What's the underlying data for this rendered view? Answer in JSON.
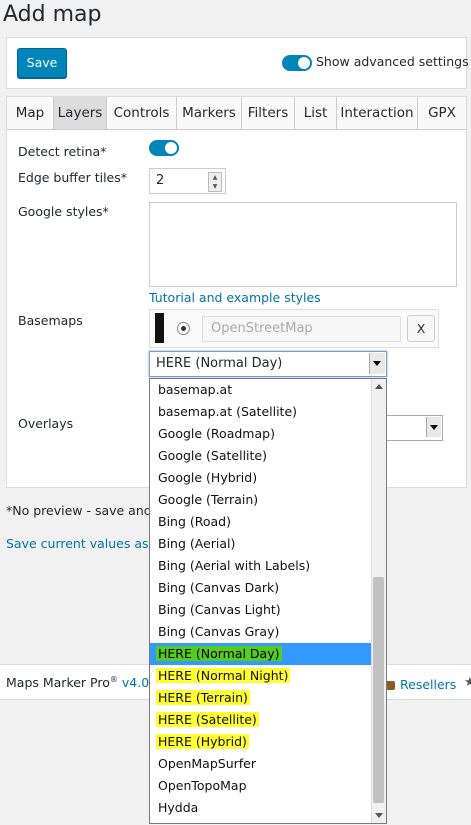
{
  "page": {
    "title": "Add map"
  },
  "topbar": {
    "save_label": "Save",
    "advanced_label": "Show advanced settings"
  },
  "tabs": [
    {
      "label": "Map"
    },
    {
      "label": "Layers"
    },
    {
      "label": "Controls"
    },
    {
      "label": "Markers"
    },
    {
      "label": "Filters"
    },
    {
      "label": "List"
    },
    {
      "label": "Interaction"
    },
    {
      "label": "GPX"
    }
  ],
  "layers": {
    "detect_retina_label": "Detect retina*",
    "edge_buffer_label": "Edge buffer tiles*",
    "edge_buffer_value": "2",
    "google_styles_label": "Google styles*",
    "tutorial_link": "Tutorial and example styles",
    "basemaps_label": "Basemaps",
    "basemap_placeholder": "OpenStreetMap",
    "remove_label": "X",
    "overlays_label": "Overlays",
    "select_value": "HERE (Normal Day)"
  },
  "dropdown": {
    "options": [
      "basemap.at",
      "basemap.at (Satellite)",
      "Google (Roadmap)",
      "Google (Satellite)",
      "Google (Hybrid)",
      "Google (Terrain)",
      "Bing (Road)",
      "Bing (Aerial)",
      "Bing (Aerial with Labels)",
      "Bing (Canvas Dark)",
      "Bing (Canvas Light)",
      "Bing (Canvas Gray)",
      "HERE (Normal Day)",
      "HERE (Normal Night)",
      "HERE (Terrain)",
      "HERE (Satellite)",
      "HERE (Hybrid)",
      "OpenMapSurfer",
      "OpenTopoMap",
      "Hydda"
    ]
  },
  "note_text": "*No preview - save and r",
  "save_current_link": "Save current values as de",
  "footer": {
    "brand": "Maps Marker Pro",
    "reg": "®",
    "version": "v4.0",
    "resellers": "Resellers"
  },
  "colors": {
    "accent": "#0085ba",
    "selected_option": "#3399ff",
    "highlight_yellow": "#ffff33",
    "highlight_green": "#55cc22",
    "link": "#0073aa"
  }
}
